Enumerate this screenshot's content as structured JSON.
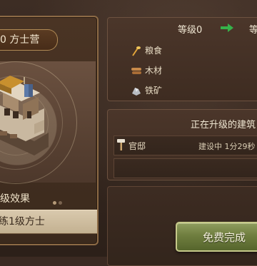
{
  "building": {
    "title": "0 方士营",
    "effect_label": "级效果",
    "effect_text": "练1级方士"
  },
  "upgrade_levels": {
    "current": "等级0",
    "next": "等"
  },
  "resources": [
    {
      "icon": "wheat-icon",
      "label": "粮食"
    },
    {
      "icon": "wood-icon",
      "label": "木材"
    },
    {
      "icon": "iron-ore-icon",
      "label": "铁矿"
    }
  ],
  "upgrading": {
    "header": "正在升级的建筑",
    "items": [
      {
        "name": "官邸",
        "status": "建设中 1分29秒"
      }
    ]
  },
  "actions": {
    "free_complete": "免费完成"
  },
  "colors": {
    "arrow": "#36b24a",
    "button": "#6f7e3f",
    "panel": "#4b362a"
  }
}
